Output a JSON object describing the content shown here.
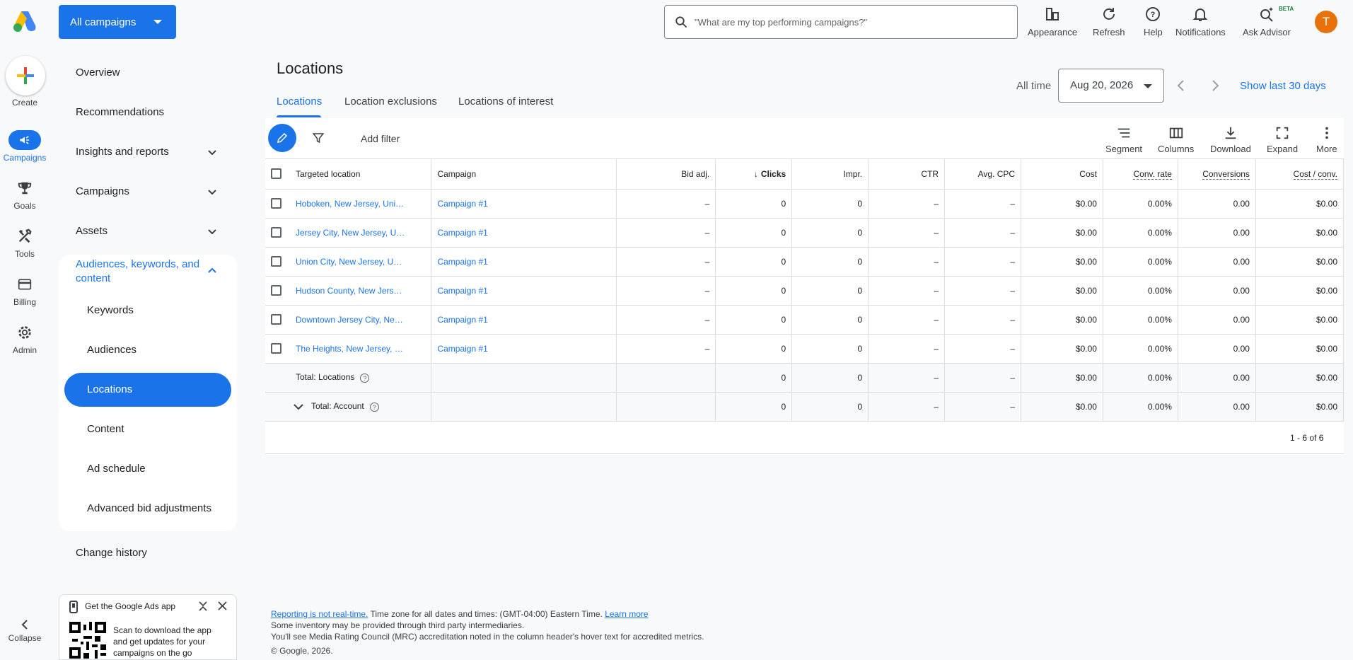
{
  "header": {
    "account_selector": "All campaigns",
    "search_placeholder": "\"What are my top performing campaigns?\"",
    "tools": [
      {
        "label": "Appearance",
        "icon": "appearance-icon"
      },
      {
        "label": "Refresh",
        "icon": "refresh-icon"
      },
      {
        "label": "Help",
        "icon": "help-icon"
      },
      {
        "label": "Notifications",
        "icon": "bell-icon"
      },
      {
        "label": "Ask Advisor",
        "icon": "advisor-icon"
      }
    ],
    "beta_badge": "BETA",
    "avatar_initial": "T"
  },
  "rail": {
    "create": "Create",
    "items": [
      {
        "label": "Campaigns",
        "icon": "megaphone-icon"
      },
      {
        "label": "Goals",
        "icon": "trophy-icon"
      },
      {
        "label": "Tools",
        "icon": "tools-icon"
      },
      {
        "label": "Billing",
        "icon": "card-icon"
      },
      {
        "label": "Admin",
        "icon": "gear-icon"
      }
    ],
    "collapse": "Collapse"
  },
  "nav": {
    "overview": "Overview",
    "recommendations": "Recommendations",
    "insights": "Insights and reports",
    "campaigns": "Campaigns",
    "assets": "Assets",
    "audiences_line1": "Audiences, keywords, and",
    "audiences_line2": "content",
    "sub": [
      "Keywords",
      "Audiences",
      "Locations",
      "Content",
      "Ad schedule",
      "Advanced bid adjustments"
    ],
    "change_history": "Change history"
  },
  "app_promo": {
    "title": "Get the Google Ads app",
    "text_line1": "Scan to download the app",
    "text_line2": "and get updates for your",
    "text_line3": "campaigns on the go"
  },
  "page": {
    "title": "Locations",
    "tabs": [
      "Locations",
      "Location exclusions",
      "Locations of interest"
    ],
    "date_label": "All time",
    "date_value": "Aug 20, 2026",
    "show_last": "Show last 30 days"
  },
  "toolbar": {
    "add_filter": "Add filter",
    "tools": [
      "Segment",
      "Columns",
      "Download",
      "Expand",
      "More"
    ]
  },
  "table": {
    "columns": [
      "Targeted location",
      "Campaign",
      "Bid adj.",
      "Clicks",
      "Impr.",
      "CTR",
      "Avg. CPC",
      "Cost",
      "Conv. rate",
      "Conversions",
      "Cost / conv."
    ],
    "rows": [
      {
        "location": "Hoboken, New Jersey, Uni…",
        "campaign": "Campaign #1",
        "bid": "–",
        "clicks": "0",
        "impr": "0",
        "ctr": "–",
        "cpc": "–",
        "cost": "$0.00",
        "conv_rate": "0.00%",
        "conversions": "0.00",
        "cost_conv": "$0.00"
      },
      {
        "location": "Jersey City, New Jersey, U…",
        "campaign": "Campaign #1",
        "bid": "–",
        "clicks": "0",
        "impr": "0",
        "ctr": "–",
        "cpc": "–",
        "cost": "$0.00",
        "conv_rate": "0.00%",
        "conversions": "0.00",
        "cost_conv": "$0.00"
      },
      {
        "location": "Union City, New Jersey, U…",
        "campaign": "Campaign #1",
        "bid": "–",
        "clicks": "0",
        "impr": "0",
        "ctr": "–",
        "cpc": "–",
        "cost": "$0.00",
        "conv_rate": "0.00%",
        "conversions": "0.00",
        "cost_conv": "$0.00"
      },
      {
        "location": "Hudson County, New Jers…",
        "campaign": "Campaign #1",
        "bid": "–",
        "clicks": "0",
        "impr": "0",
        "ctr": "–",
        "cpc": "–",
        "cost": "$0.00",
        "conv_rate": "0.00%",
        "conversions": "0.00",
        "cost_conv": "$0.00"
      },
      {
        "location": "Downtown Jersey City, Ne…",
        "campaign": "Campaign #1",
        "bid": "–",
        "clicks": "0",
        "impr": "0",
        "ctr": "–",
        "cpc": "–",
        "cost": "$0.00",
        "conv_rate": "0.00%",
        "conversions": "0.00",
        "cost_conv": "$0.00"
      },
      {
        "location": "The Heights, New Jersey, …",
        "campaign": "Campaign #1",
        "bid": "–",
        "clicks": "0",
        "impr": "0",
        "ctr": "–",
        "cpc": "–",
        "cost": "$0.00",
        "conv_rate": "0.00%",
        "conversions": "0.00",
        "cost_conv": "$0.00"
      }
    ],
    "totals": [
      {
        "label": "Total: Locations",
        "clicks": "0",
        "impr": "0",
        "ctr": "–",
        "cpc": "–",
        "cost": "$0.00",
        "conv_rate": "0.00%",
        "conversions": "0.00",
        "cost_conv": "$0.00"
      },
      {
        "label": "Total: Account",
        "clicks": "0",
        "impr": "0",
        "ctr": "–",
        "cpc": "–",
        "cost": "$0.00",
        "conv_rate": "0.00%",
        "conversions": "0.00",
        "cost_conv": "$0.00"
      }
    ],
    "pager": "1 - 6 of 6"
  },
  "footer": {
    "reporting_link": "Reporting is not real-time.",
    "timezone": " Time zone for all dates and times: (GMT-04:00) Eastern Time. ",
    "learn_more": "Learn more",
    "line2": "Some inventory may be provided through third party intermediaries.",
    "line3": "You'll see Media Rating Council (MRC) accreditation noted in the column header's hover text for accredited metrics.",
    "copyright": "© Google, 2026."
  },
  "colors": {
    "brand_blue": "#1a73e8",
    "avatar": "#e8710a"
  }
}
